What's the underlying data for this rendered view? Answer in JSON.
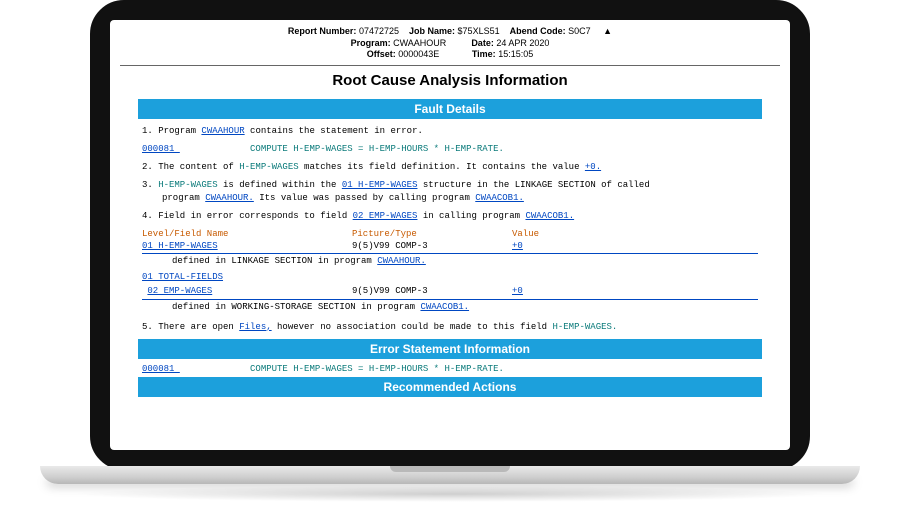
{
  "header": {
    "report_label": "Report Number:",
    "report_value": "07472725",
    "job_label": "Job Name:",
    "job_value": "$75XLS51",
    "abend_label": "Abend Code:",
    "abend_value": "S0C7",
    "program_label": "Program:",
    "program_value": "CWAAHOUR",
    "date_label": "Date:",
    "date_value": "24 APR 2020",
    "offset_label": "Offset:",
    "offset_value": "0000043E",
    "time_label": "Time:",
    "time_value": "15:15:05"
  },
  "title": "Root Cause Analysis Information",
  "sections": {
    "fault_details": "Fault Details",
    "error_stmt": "Error Statement Information",
    "rec_actions": "Recommended Actions"
  },
  "fault": {
    "n1_a": "1. Program ",
    "n1_link": "CWAAHOUR",
    "n1_b": " contains the statement in error.",
    "stmt_link": "000081 ",
    "stmt_text": "COMPUTE H-EMP-WAGES = H-EMP-HOURS * H-EMP-RATE.",
    "n2_a": "2. The content of ",
    "n2_field": "H-EMP-WAGES",
    "n2_b": " matches its field definition. It contains the value ",
    "n2_val": "+0.",
    "n3_a": "3. ",
    "n3_field": "H-EMP-WAGES",
    "n3_b": " is defined within the ",
    "n3_link1": "01 H-EMP-WAGES",
    "n3_c": " structure in the LINKAGE SECTION of called",
    "n3_d": "program ",
    "n3_link2": "CWAAHOUR.",
    "n3_e": " Its value was passed by calling program ",
    "n3_link3": "CWAACOB1.",
    "n4_a": "4. Field in error corresponds to field ",
    "n4_link": "02 EMP-WAGES",
    "n4_b": " in calling program ",
    "n4_prog": "CWAACOB1.",
    "tbl_h1": "Level/Field Name",
    "tbl_h2": "Picture/Type",
    "tbl_h3": "Value",
    "r1_name": "01 H-EMP-WAGES",
    "r1_pic": "9(5)V99  COMP-3",
    "r1_val": "+0",
    "r1_sub_a": "defined in LINKAGE SECTION in program ",
    "r1_sub_link": "CWAAHOUR.",
    "r2_name": "01 TOTAL-FIELDS",
    "r3_name": "02 EMP-WAGES",
    "r3_pic": "9(5)V99  COMP-3",
    "r3_val": "+0",
    "r3_sub_a": "defined in WORKING-STORAGE SECTION in program ",
    "r3_sub_link": "CWAACOB1.",
    "n5_a": "5. There are open ",
    "n5_link": "Files,",
    "n5_b": " however no association could be made to this field ",
    "n5_field": "H-EMP-WAGES."
  },
  "err_stmt": {
    "link": "000081 ",
    "text": "COMPUTE H-EMP-WAGES = H-EMP-HOURS * H-EMP-RATE."
  }
}
